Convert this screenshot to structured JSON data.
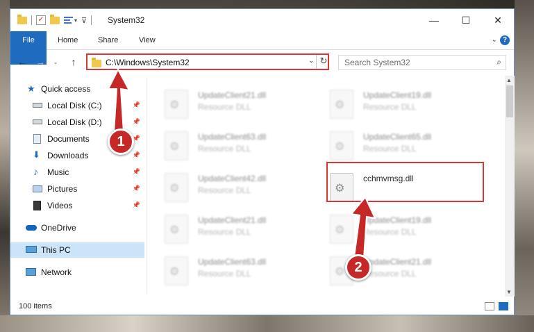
{
  "window": {
    "title": "System32",
    "controls": {
      "minimize": "—",
      "maximize": "☐",
      "close": "✕"
    }
  },
  "ribbon": {
    "tabs": [
      "File",
      "Home",
      "Share",
      "View"
    ],
    "expand": "⌄",
    "help": "?"
  },
  "navigation": {
    "back": "←",
    "forward": "→",
    "recent": "⌄",
    "up": "↑",
    "address": "C:\\Windows\\System32",
    "address_dropdown": "⌄",
    "refresh": "↻",
    "search_placeholder": "Search System32",
    "search_icon": "search-icon"
  },
  "sidebar": {
    "items": [
      {
        "label": "Quick access",
        "icon": "star-icon",
        "pinned": false
      },
      {
        "label": "Local Disk (C:)",
        "icon": "drive-icon",
        "pinned": true
      },
      {
        "label": "Local Disk (D:)",
        "icon": "drive-icon",
        "pinned": true
      },
      {
        "label": "Documents",
        "icon": "documents-icon",
        "pinned": true
      },
      {
        "label": "Downloads",
        "icon": "download-icon",
        "pinned": true
      },
      {
        "label": "Music",
        "icon": "music-icon",
        "pinned": true
      },
      {
        "label": "Pictures",
        "icon": "pictures-icon",
        "pinned": true
      },
      {
        "label": "Videos",
        "icon": "videos-icon",
        "pinned": true
      },
      {
        "label": "OneDrive",
        "icon": "cloud-icon",
        "pinned": false
      },
      {
        "label": "This PC",
        "icon": "computer-icon",
        "pinned": false
      },
      {
        "label": "Network",
        "icon": "network-icon",
        "pinned": false
      }
    ],
    "pin_glyph": "📌"
  },
  "files": [
    {
      "name": "UpdateClient21.dll",
      "type": "Resource DLL"
    },
    {
      "name": "UpdateClient19.dll",
      "type": "Resource DLL"
    },
    {
      "name": "UpdateClient63.dll",
      "type": "Resource DLL"
    },
    {
      "name": "UpdateClient65.dll",
      "type": "Resource DLL"
    },
    {
      "name": "UpdateClient42.dll",
      "type": "Resource DLL"
    },
    {
      "name": "cchmvmsg.dll",
      "type": ""
    },
    {
      "name": "UpdateClient21.dll",
      "type": "Resource DLL"
    },
    {
      "name": "UpdateClient19.dll",
      "type": "Resource DLL"
    },
    {
      "name": "UpdateClient63.dll",
      "type": "Resource DLL"
    },
    {
      "name": "UpdateClient21.dll",
      "type": "Resource DLL"
    }
  ],
  "status": {
    "count": "100 items"
  },
  "callouts": [
    "1",
    "2"
  ],
  "colors": {
    "accent": "#1e6bbf",
    "highlight": "#d7363b",
    "callout": "#c62828"
  }
}
